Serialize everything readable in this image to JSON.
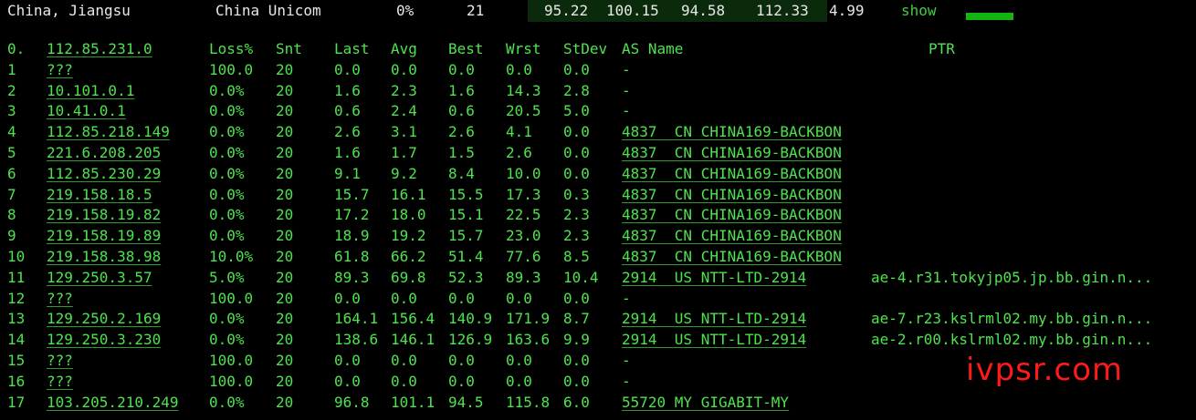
{
  "header": {
    "location": "China, Jiangsu",
    "isp": "China Unicom",
    "loss": "0%",
    "count": "21",
    "v1": "95.22",
    "v2": "100.15",
    "v3": "94.58",
    "v4": "112.33",
    "v5": "4.99",
    "show_link": "show"
  },
  "table": {
    "columns": [
      "0.",
      "112.85.231.0",
      "Loss%",
      "Snt",
      "Last",
      "Avg",
      "Best",
      "Wrst",
      "StDev",
      "AS Name",
      "PTR"
    ],
    "rows": [
      {
        "hop": "1",
        "ip": "???",
        "loss": "100.0",
        "snt": "20",
        "last": "0.0",
        "avg": "0.0",
        "best": "0.0",
        "wrst": "0.0",
        "stdev": "0.0",
        "asn": "-",
        "ptr": ""
      },
      {
        "hop": "2",
        "ip": "10.101.0.1",
        "loss": "0.0%",
        "snt": "20",
        "last": "1.6",
        "avg": "2.3",
        "best": "1.6",
        "wrst": "14.3",
        "stdev": "2.8",
        "asn": "-",
        "ptr": ""
      },
      {
        "hop": "3",
        "ip": "10.41.0.1",
        "loss": "0.0%",
        "snt": "20",
        "last": "0.6",
        "avg": "2.4",
        "best": "0.6",
        "wrst": "20.5",
        "stdev": "5.0",
        "asn": "-",
        "ptr": ""
      },
      {
        "hop": "4",
        "ip": "112.85.218.149",
        "loss": "0.0%",
        "snt": "20",
        "last": "2.6",
        "avg": "3.1",
        "best": "2.6",
        "wrst": "4.1",
        "stdev": "0.0",
        "asn": "4837  CN CHINA169-BACKBON",
        "ptr": ""
      },
      {
        "hop": "5",
        "ip": "221.6.208.205",
        "loss": "0.0%",
        "snt": "20",
        "last": "1.6",
        "avg": "1.7",
        "best": "1.5",
        "wrst": "2.6",
        "stdev": "0.0",
        "asn": "4837  CN CHINA169-BACKBON",
        "ptr": ""
      },
      {
        "hop": "6",
        "ip": "112.85.230.29",
        "loss": "0.0%",
        "snt": "20",
        "last": "9.1",
        "avg": "9.2",
        "best": "8.4",
        "wrst": "10.0",
        "stdev": "0.0",
        "asn": "4837  CN CHINA169-BACKBON",
        "ptr": ""
      },
      {
        "hop": "7",
        "ip": "219.158.18.5",
        "loss": "0.0%",
        "snt": "20",
        "last": "15.7",
        "avg": "16.1",
        "best": "15.5",
        "wrst": "17.3",
        "stdev": "0.3",
        "asn": "4837  CN CHINA169-BACKBON",
        "ptr": ""
      },
      {
        "hop": "8",
        "ip": "219.158.19.82",
        "loss": "0.0%",
        "snt": "20",
        "last": "17.2",
        "avg": "18.0",
        "best": "15.1",
        "wrst": "22.5",
        "stdev": "2.3",
        "asn": "4837  CN CHINA169-BACKBON",
        "ptr": ""
      },
      {
        "hop": "9",
        "ip": "219.158.19.89",
        "loss": "0.0%",
        "snt": "20",
        "last": "18.9",
        "avg": "19.2",
        "best": "15.7",
        "wrst": "23.0",
        "stdev": "2.3",
        "asn": "4837  CN CHINA169-BACKBON",
        "ptr": ""
      },
      {
        "hop": "10",
        "ip": "219.158.38.98",
        "loss": "10.0%",
        "snt": "20",
        "last": "61.8",
        "avg": "66.2",
        "best": "51.4",
        "wrst": "77.6",
        "stdev": "8.5",
        "asn": "4837  CN CHINA169-BACKBON",
        "ptr": ""
      },
      {
        "hop": "11",
        "ip": "129.250.3.57",
        "loss": "5.0%",
        "snt": "20",
        "last": "89.3",
        "avg": "69.8",
        "best": "52.3",
        "wrst": "89.3",
        "stdev": "10.4",
        "asn": "2914  US NTT-LTD-2914",
        "ptr": "ae-4.r31.tokyjp05.jp.bb.gin.n..."
      },
      {
        "hop": "12",
        "ip": "???",
        "loss": "100.0",
        "snt": "20",
        "last": "0.0",
        "avg": "0.0",
        "best": "0.0",
        "wrst": "0.0",
        "stdev": "0.0",
        "asn": "-",
        "ptr": ""
      },
      {
        "hop": "13",
        "ip": "129.250.2.169",
        "loss": "0.0%",
        "snt": "20",
        "last": "164.1",
        "avg": "156.4",
        "best": "140.9",
        "wrst": "171.9",
        "stdev": "8.7",
        "asn": "2914  US NTT-LTD-2914",
        "ptr": "ae-7.r23.kslrml02.my.bb.gin.n..."
      },
      {
        "hop": "14",
        "ip": "129.250.3.230",
        "loss": "0.0%",
        "snt": "20",
        "last": "138.6",
        "avg": "146.1",
        "best": "126.9",
        "wrst": "163.6",
        "stdev": "9.9",
        "asn": "2914  US NTT-LTD-2914",
        "ptr": "ae-2.r00.kslrml02.my.bb.gin.n..."
      },
      {
        "hop": "15",
        "ip": "???",
        "loss": "100.0",
        "snt": "20",
        "last": "0.0",
        "avg": "0.0",
        "best": "0.0",
        "wrst": "0.0",
        "stdev": "0.0",
        "asn": "-",
        "ptr": ""
      },
      {
        "hop": "16",
        "ip": "???",
        "loss": "100.0",
        "snt": "20",
        "last": "0.0",
        "avg": "0.0",
        "best": "0.0",
        "wrst": "0.0",
        "stdev": "0.0",
        "asn": "-",
        "ptr": ""
      },
      {
        "hop": "17",
        "ip": "103.205.210.249",
        "loss": "0.0%",
        "snt": "20",
        "last": "96.8",
        "avg": "101.1",
        "best": "94.5",
        "wrst": "115.8",
        "stdev": "6.0",
        "asn": "55720 MY GIGABIT-MY",
        "ptr": ""
      }
    ]
  },
  "watermark": "ivpsr.com",
  "colors": {
    "text_green": "#4ee34e",
    "header_bg": "#0b2a0b",
    "bar_green": "#13b513",
    "watermark_red": "#ff1a1a"
  }
}
